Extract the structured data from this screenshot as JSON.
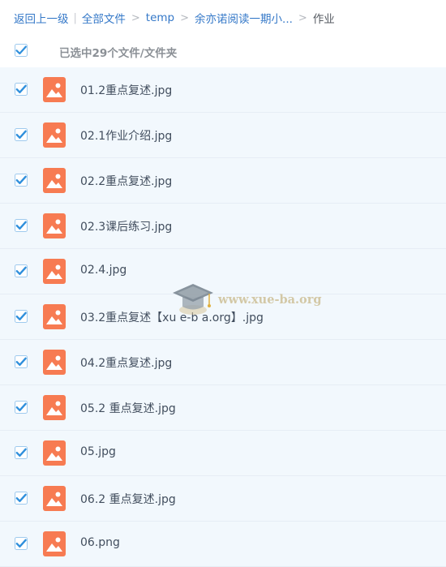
{
  "breadcrumb": {
    "back": "返回上一级",
    "root": "全部文件",
    "level1": "temp",
    "level2": "余亦诺阅读一期小...",
    "current": "作业"
  },
  "selection": {
    "summary": "已选中29个文件/文件夹",
    "all_checked": true
  },
  "files": [
    {
      "name": "01.2重点复述.jpg",
      "checked": true,
      "icon": "image-file-icon"
    },
    {
      "name": "02.1作业介绍.jpg",
      "checked": true,
      "icon": "image-file-icon"
    },
    {
      "name": "02.2重点复述.jpg",
      "checked": true,
      "icon": "image-file-icon"
    },
    {
      "name": "02.3课后练习.jpg",
      "checked": true,
      "icon": "image-file-icon"
    },
    {
      "name": "02.4.jpg",
      "checked": true,
      "icon": "image-file-icon"
    },
    {
      "name": "03.2重点复述【xu e-b a.org】.jpg",
      "checked": true,
      "icon": "image-file-icon"
    },
    {
      "name": "04.2重点复述.jpg",
      "checked": true,
      "icon": "image-file-icon"
    },
    {
      "name": "05.2 重点复述.jpg",
      "checked": true,
      "icon": "image-file-icon"
    },
    {
      "name": "05.jpg",
      "checked": true,
      "icon": "image-file-icon"
    },
    {
      "name": "06.2 重点复述.jpg",
      "checked": true,
      "icon": "image-file-icon"
    },
    {
      "name": "06.png",
      "checked": true,
      "icon": "image-file-icon"
    }
  ],
  "watermark": {
    "text": "www.xue-ba.org",
    "icon": "graduation-cap-icon"
  },
  "colors": {
    "link": "#3478c8",
    "checkbox": "#2f8fdc",
    "file_icon": "#f77b52",
    "row_bg": "#f2f8fd",
    "row_text": "#424e5e"
  }
}
